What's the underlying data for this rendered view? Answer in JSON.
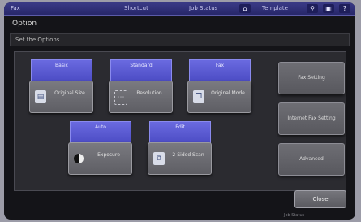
{
  "topbar": {
    "user": "Fax",
    "menu1": "Shortcut",
    "menu2": "Job Status",
    "menu3": "Template",
    "icons": [
      "home-icon",
      "search-icon",
      "printer-icon",
      "help-icon"
    ]
  },
  "window_title": "Option",
  "subtitle": "Set the Options",
  "categories": [
    {
      "label": "Basic"
    },
    {
      "label": "Standard"
    },
    {
      "label": "Fax"
    },
    {
      "label": "Auto"
    },
    {
      "label": "Edit"
    }
  ],
  "cards": [
    {
      "label": "Original Size",
      "icon": "document-icon"
    },
    {
      "label": "Resolution",
      "icon": "resolution-icon"
    },
    {
      "label": "Original Mode",
      "icon": "original-mode-icon"
    },
    {
      "label": "Exposure",
      "icon": "exposure-icon"
    },
    {
      "label": "2-Sided Scan",
      "icon": "two-sided-icon"
    }
  ],
  "side_buttons": [
    {
      "label": "Fax Setting"
    },
    {
      "label": "Internet Fax Setting"
    },
    {
      "label": "Advanced"
    }
  ],
  "close_label": "Close",
  "footer_text": "Job Status"
}
